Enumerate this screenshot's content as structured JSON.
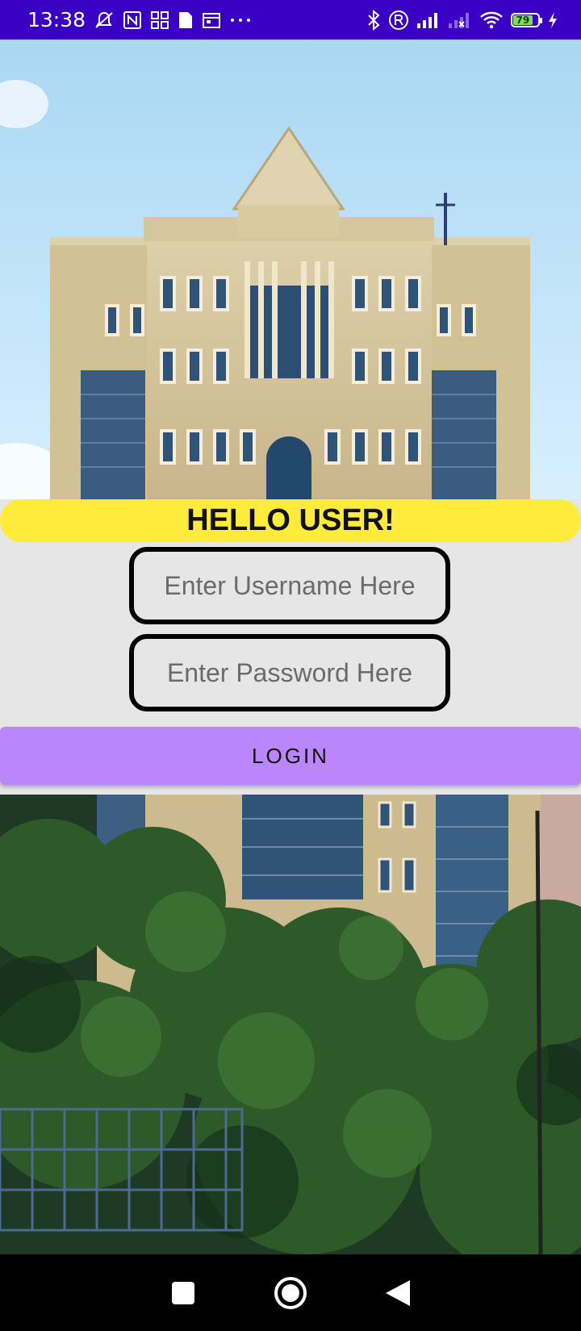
{
  "status_bar": {
    "time": "13:38",
    "battery_level": "79",
    "icons_left": [
      "mute-icon",
      "nfc-icon",
      "qr-icon",
      "sim-icon",
      "calendar-icon",
      "more-icon"
    ],
    "icons_right": [
      "bluetooth-icon",
      "registered-icon",
      "signal-icon",
      "signal-x-icon",
      "wifi-icon",
      "battery-icon",
      "charging-icon"
    ],
    "background_color": "#3a00c4"
  },
  "header_image": {
    "description_icon": "building-photo"
  },
  "greeting": {
    "text": "HELLO USER!",
    "background_color": "#ffeb3b"
  },
  "form": {
    "username_placeholder": "Enter Username Here",
    "password_placeholder": "Enter Password Here",
    "login_label": "LOGIN",
    "login_color": "#bb86fc"
  },
  "footer_image": {
    "description_icon": "campus-photo"
  },
  "nav_bar": {
    "buttons": [
      "recents-icon",
      "home-icon",
      "back-icon"
    ]
  }
}
